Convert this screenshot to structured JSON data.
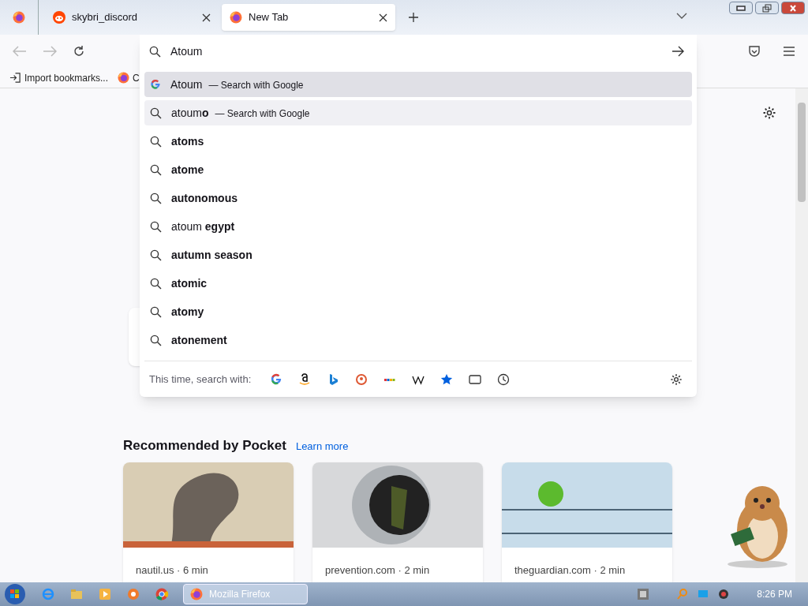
{
  "tabs": [
    {
      "title": "skybri_discord",
      "selected": false
    },
    {
      "title": "New Tab",
      "selected": true
    }
  ],
  "address_bar": {
    "value": "Atoum"
  },
  "bookmarks": [
    {
      "label": "Import bookmarks..."
    },
    {
      "label": "C"
    }
  ],
  "suggestions": [
    {
      "kind": "engine",
      "text": "Atoum",
      "suffix": "— Search with Google",
      "selected": true,
      "hovered": false
    },
    {
      "kind": "search",
      "text": "atoum**o**",
      "suffix": "— Search with Google",
      "selected": false,
      "hovered": true
    },
    {
      "kind": "search",
      "text": "**atoms**",
      "selected": false,
      "hovered": false
    },
    {
      "kind": "search",
      "text": "**atome**",
      "selected": false,
      "hovered": false
    },
    {
      "kind": "search",
      "text": "**autonomous**",
      "selected": false,
      "hovered": false
    },
    {
      "kind": "search",
      "text": "atoum **egypt**",
      "selected": false,
      "hovered": false
    },
    {
      "kind": "search",
      "text": "**autumn season**",
      "selected": false,
      "hovered": false
    },
    {
      "kind": "search",
      "text": "**atomic**",
      "selected": false,
      "hovered": false
    },
    {
      "kind": "search",
      "text": "**atomy**",
      "selected": false,
      "hovered": false
    },
    {
      "kind": "search",
      "text": "**atonement**",
      "selected": false,
      "hovered": false
    }
  ],
  "search_with": {
    "label": "This time, search with:"
  },
  "pocket": {
    "heading": "Recommended by Pocket",
    "link": "Learn more",
    "cards": [
      {
        "source": "nautil.us · 6 min"
      },
      {
        "source": "prevention.com · 2 min"
      },
      {
        "source": "theguardian.com · 2 min"
      }
    ]
  },
  "taskbar": {
    "window": "Mozilla Firefox",
    "clock": "8:26 PM"
  }
}
